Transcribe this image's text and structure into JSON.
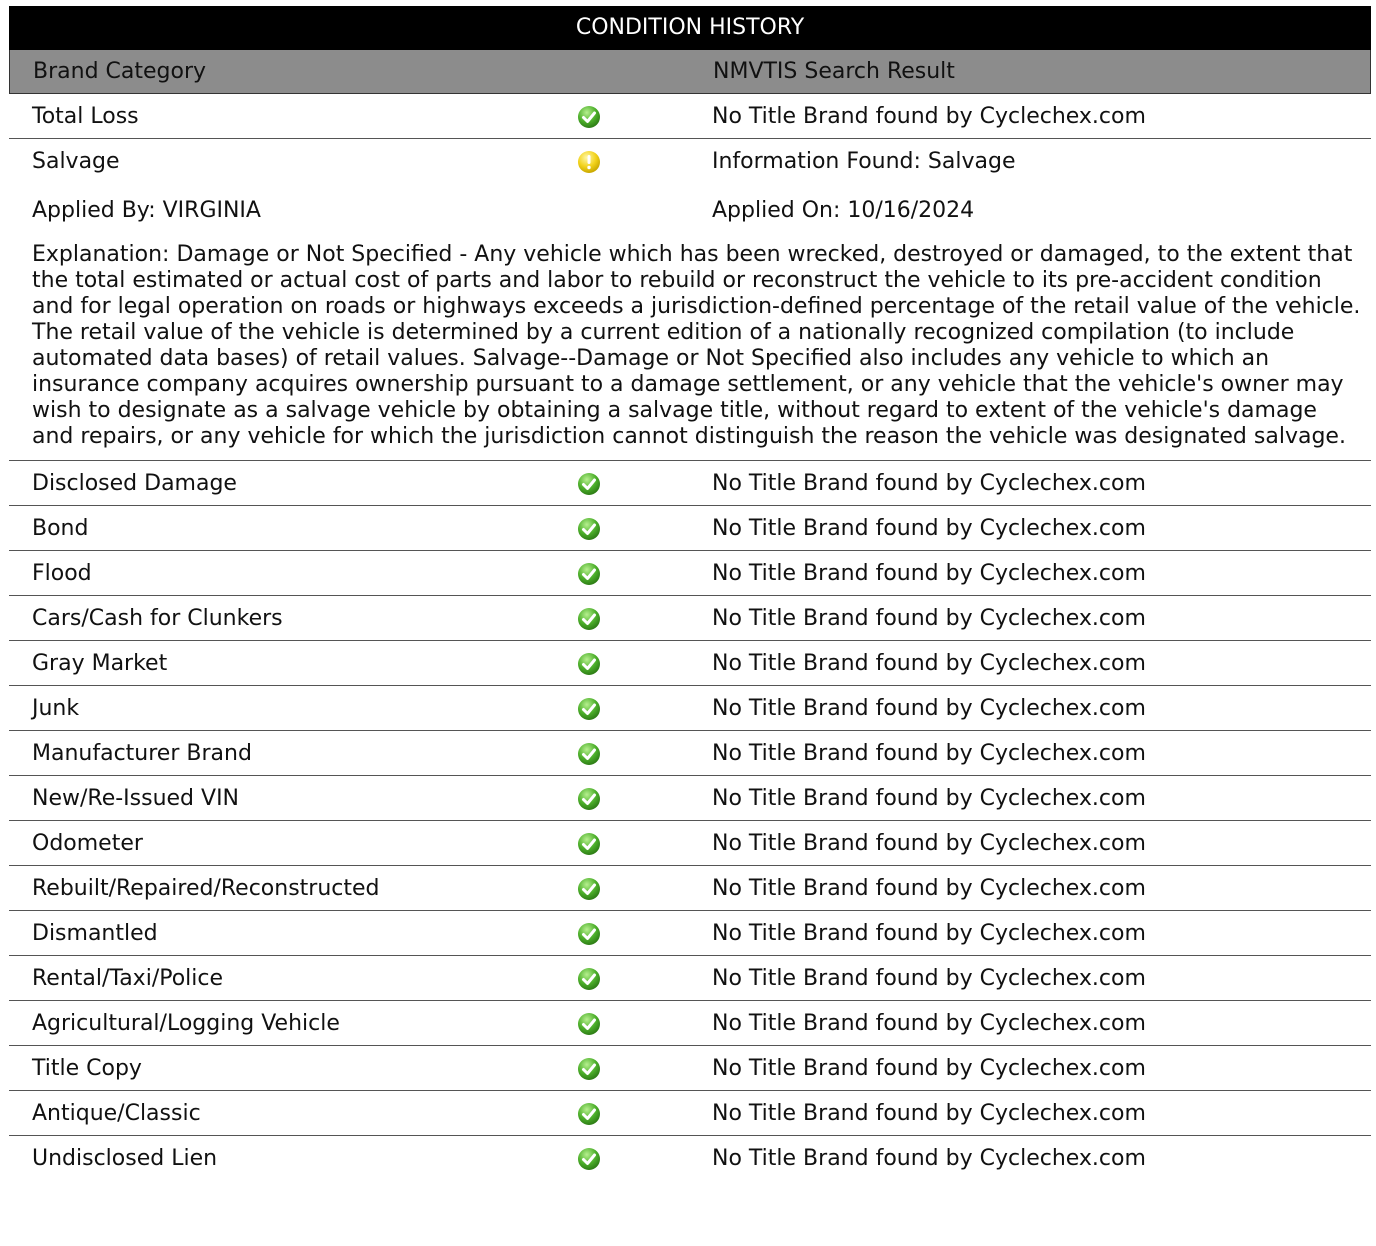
{
  "title": "CONDITION HISTORY",
  "headers": {
    "brand_category": "Brand Category",
    "search_result": "NMVTIS Search Result"
  },
  "rows": [
    {
      "category": "Total Loss",
      "status": "ok",
      "result": "No Title Brand found by Cyclechex.com"
    },
    {
      "category": "Salvage",
      "status": "warning",
      "result": "Information Found: Salvage"
    }
  ],
  "salvage_detail": {
    "applied_by": "Applied By: VIRGINIA",
    "applied_on": "Applied On: 10/16/2024",
    "explanation": "Explanation: Damage or Not Specified - Any vehicle which has been wrecked, destroyed or damaged, to the extent that the total estimated or actual cost of parts and labor to rebuild or reconstruct the vehicle to its pre-accident condition and for legal operation on roads or highways exceeds a jurisdiction-defined percentage of the retail value of the vehicle.  The retail value of the vehicle is determined by a current edition of a nationally recognized compilation (to include automated data bases) of retail values.  Salvage--Damage or Not Specified also includes any vehicle to which an insurance company acquires ownership pursuant to a damage settlement, or any vehicle that the vehicle's owner may wish to designate as a salvage vehicle by obtaining a salvage title, without regard to extent of the vehicle's damage and repairs, or any vehicle for which the jurisdiction cannot distinguish the reason the vehicle was designated salvage."
  },
  "more_rows": [
    {
      "category": "Disclosed Damage",
      "status": "ok",
      "result": "No Title Brand found by Cyclechex.com"
    },
    {
      "category": "Bond",
      "status": "ok",
      "result": "No Title Brand found by Cyclechex.com"
    },
    {
      "category": "Flood",
      "status": "ok",
      "result": "No Title Brand found by Cyclechex.com"
    },
    {
      "category": "Cars/Cash for Clunkers",
      "status": "ok",
      "result": "No Title Brand found by Cyclechex.com"
    },
    {
      "category": "Gray Market",
      "status": "ok",
      "result": "No Title Brand found by Cyclechex.com"
    },
    {
      "category": "Junk",
      "status": "ok",
      "result": "No Title Brand found by Cyclechex.com"
    },
    {
      "category": "Manufacturer Brand",
      "status": "ok",
      "result": "No Title Brand found by Cyclechex.com"
    },
    {
      "category": "New/Re-Issued VIN",
      "status": "ok",
      "result": "No Title Brand found by Cyclechex.com"
    },
    {
      "category": "Odometer",
      "status": "ok",
      "result": "No Title Brand found by Cyclechex.com"
    },
    {
      "category": "Rebuilt/Repaired/Reconstructed",
      "status": "ok",
      "result": "No Title Brand found by Cyclechex.com"
    },
    {
      "category": "Dismantled",
      "status": "ok",
      "result": "No Title Brand found by Cyclechex.com"
    },
    {
      "category": "Rental/Taxi/Police",
      "status": "ok",
      "result": "No Title Brand found by Cyclechex.com"
    },
    {
      "category": "Agricultural/Logging Vehicle",
      "status": "ok",
      "result": "No Title Brand found by Cyclechex.com"
    },
    {
      "category": "Title Copy",
      "status": "ok",
      "result": "No Title Brand found by Cyclechex.com"
    },
    {
      "category": "Antique/Classic",
      "status": "ok",
      "result": "No Title Brand found by Cyclechex.com"
    },
    {
      "category": "Undisclosed Lien",
      "status": "ok",
      "result": "No Title Brand found by Cyclechex.com"
    }
  ],
  "icons": {
    "ok": "green-check-icon",
    "warning": "yellow-exclamation-icon"
  },
  "colors": {
    "title_bg": "#000000",
    "header_bg": "#8c8c8c",
    "ok": "#4caf2a",
    "warning": "#f2d21a"
  }
}
